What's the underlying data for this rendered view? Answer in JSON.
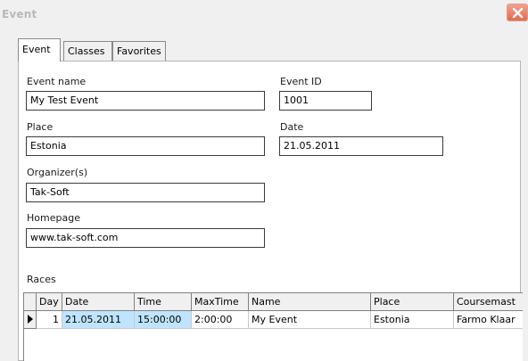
{
  "window": {
    "title": "Event"
  },
  "tabs": [
    {
      "label": "Event",
      "active": true
    },
    {
      "label": "Classes",
      "active": false
    },
    {
      "label": "Favorites",
      "active": false
    }
  ],
  "form": {
    "event_name": {
      "label": "Event name",
      "value": "My Test Event"
    },
    "event_id": {
      "label": "Event ID",
      "value": "1001"
    },
    "place": {
      "label": "Place",
      "value": "Estonia"
    },
    "date": {
      "label": "Date",
      "value": "21.05.2011"
    },
    "organizer": {
      "label": "Organizer(s)",
      "value": "Tak-Soft"
    },
    "homepage": {
      "label": "Homepage",
      "value": "www.tak-soft.com"
    }
  },
  "races": {
    "label": "Races",
    "columns": [
      "Day",
      "Date",
      "Time",
      "MaxTime",
      "Name",
      "Place",
      "Coursemast"
    ],
    "rows": [
      {
        "day": "1",
        "date": "21.05.2011",
        "time": "15:00:00",
        "maxtime": "2:00:00",
        "name": "My Event",
        "place": "Estonia",
        "coursemaster": "Farmo Klaar"
      }
    ]
  },
  "icons": {
    "close": "close-icon",
    "row_indicator": "current-row-indicator-icon"
  },
  "colors": {
    "selected_cell": "#bfe4ff",
    "close_button": "#e26c52"
  }
}
